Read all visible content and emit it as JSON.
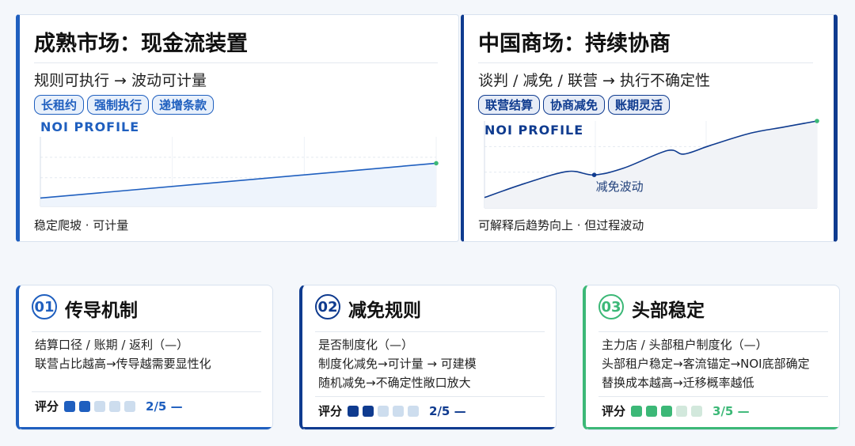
{
  "left_panel": {
    "title": "成熟市场：现金流装置",
    "subtitle": "规则可执行 → 波动可计量",
    "tags": [
      "长租约",
      "强制执行",
      "递增条款"
    ],
    "chart_label": "NOI PROFILE",
    "caption": "稳定爬坡 · 可计量",
    "accent": "#1f5fbf"
  },
  "right_panel": {
    "title": "中国商场：持续协商",
    "subtitle": "谈判 / 减免 / 联营 → 执行不确定性",
    "tags": [
      "联营结算",
      "协商减免",
      "账期灵活"
    ],
    "chart_label": "NOI PROFILE",
    "annotation": "减免波动",
    "caption": "可解释后趋势向上 · 但过程波动",
    "accent": "#0f3b8f"
  },
  "chart_data": [
    {
      "type": "line",
      "title": "NOI PROFILE",
      "x": [
        0,
        1
      ],
      "series": [
        {
          "values": [
            0.12,
            0.62
          ]
        }
      ],
      "ylim": [
        0,
        1
      ],
      "grid": true
    },
    {
      "type": "line",
      "title": "NOI PROFILE",
      "x": [
        0,
        0.12,
        0.25,
        0.33,
        0.42,
        0.55,
        0.6,
        0.68,
        0.8,
        0.9,
        1
      ],
      "series": [
        {
          "values": [
            0.12,
            0.28,
            0.42,
            0.38,
            0.46,
            0.66,
            0.62,
            0.72,
            0.86,
            0.93,
            1.0
          ]
        }
      ],
      "annotations": [
        {
          "x": 0.33,
          "text": "减免波动"
        }
      ],
      "ylim": [
        0,
        1
      ],
      "grid": true
    }
  ],
  "cards": [
    {
      "number": "01",
      "title": "传导机制",
      "lines": [
        "结算口径 / 账期 / 返利（—）",
        "联营占比越高→传导越需要显性化"
      ],
      "score_label": "评分",
      "score": 2,
      "score_max": 5,
      "score_text": "2/5 —",
      "accent": "#1f5fbf"
    },
    {
      "number": "02",
      "title": "减免规则",
      "lines": [
        "是否制度化（—）",
        "制度化减免→可计量 → 可建模",
        "随机减免→不确定性敞口放大"
      ],
      "score_label": "评分",
      "score": 2,
      "score_max": 5,
      "score_text": "2/5 —",
      "accent": "#0f3b8f"
    },
    {
      "number": "03",
      "title": "头部稳定",
      "lines": [
        "主力店 / 头部租户制度化（—）",
        "头部租户稳定→客流锚定→NOI底部确定",
        "替换成本越高→迁移概率越低"
      ],
      "score_label": "评分",
      "score": 3,
      "score_max": 5,
      "score_text": "3/5 —",
      "accent": "#3cb877"
    }
  ]
}
